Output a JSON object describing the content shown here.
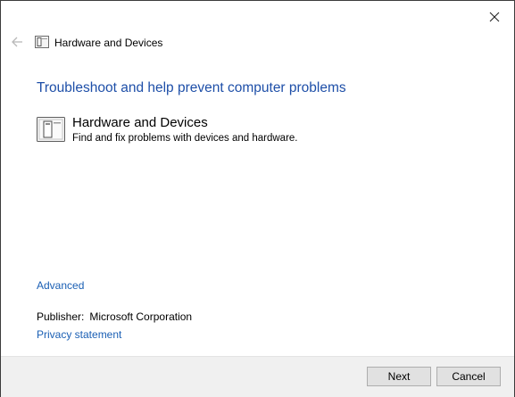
{
  "window": {
    "title": "Hardware and Devices",
    "close_icon": "close-icon",
    "back_icon": "back-arrow-icon"
  },
  "main": {
    "heading": "Troubleshoot and help prevent computer problems",
    "item": {
      "icon": "hardware-device-icon",
      "title": "Hardware and Devices",
      "description": "Find and fix problems with devices and hardware."
    },
    "advanced_link": "Advanced",
    "publisher_label": "Publisher:",
    "publisher_value": "Microsoft Corporation",
    "privacy_link": "Privacy statement"
  },
  "footer": {
    "next_label": "Next",
    "cancel_label": "Cancel"
  },
  "colors": {
    "heading": "#1e4fa8",
    "link": "#1a5fb4",
    "footer_bg": "#f0f0f0"
  }
}
